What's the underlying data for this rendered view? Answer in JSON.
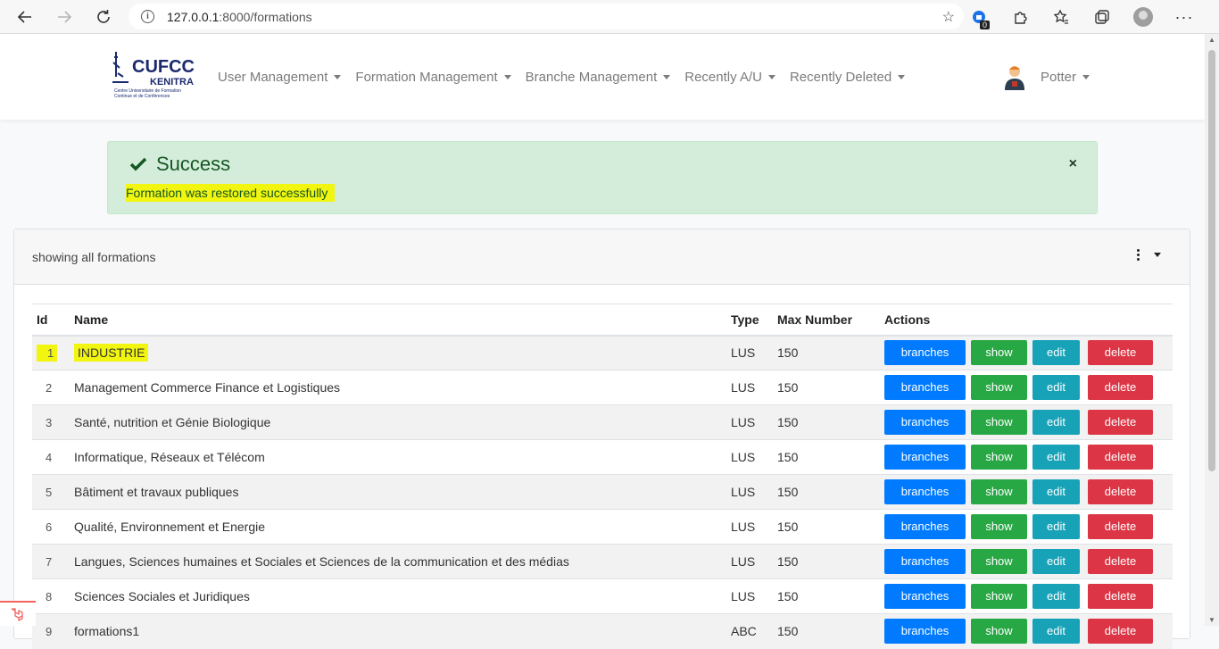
{
  "browser": {
    "url_host": "127.0.0.1",
    "url_path": ":8000/formations",
    "extension_badge": "0"
  },
  "logo": {
    "title": "CUFCC",
    "subtitle": "KENITRA",
    "tagline": "Centre Universitaire de Formation Continue et de Conférences"
  },
  "nav": {
    "items": [
      {
        "label": "User Management"
      },
      {
        "label": "Formation Management"
      },
      {
        "label": "Branche Management"
      },
      {
        "label": "Recently A/U"
      },
      {
        "label": "Recently Deleted"
      }
    ],
    "user": "Potter"
  },
  "alert": {
    "title": "Success",
    "message": "Formation was restored successfully",
    "close": "×",
    "color": "#d4edda"
  },
  "card": {
    "title": "showing all formations"
  },
  "table": {
    "headers": {
      "id": "Id",
      "name": "Name",
      "type": "Type",
      "max": "Max Number",
      "actions": "Actions"
    },
    "button_labels": {
      "branches": "branches",
      "show": "show",
      "edit": "edit",
      "delete": "delete"
    },
    "rows": [
      {
        "id": "1",
        "name": "INDUSTRIE",
        "type": "LUS",
        "max": "150"
      },
      {
        "id": "2",
        "name": "Management Commerce Finance et Logistiques",
        "type": "LUS",
        "max": "150"
      },
      {
        "id": "3",
        "name": "Santé, nutrition et Génie Biologique",
        "type": "LUS",
        "max": "150"
      },
      {
        "id": "4",
        "name": "Informatique, Réseaux et Télécom",
        "type": "LUS",
        "max": "150"
      },
      {
        "id": "5",
        "name": "Bâtiment et travaux publiques",
        "type": "LUS",
        "max": "150"
      },
      {
        "id": "6",
        "name": "Qualité, Environnement et Energie",
        "type": "LUS",
        "max": "150"
      },
      {
        "id": "7",
        "name": "Langues, Sciences humaines et Sociales et Sciences de la communication et des médias",
        "type": "LUS",
        "max": "150"
      },
      {
        "id": "8",
        "name": "Sciences Sociales et Juridiques",
        "type": "LUS",
        "max": "150"
      },
      {
        "id": "9",
        "name": "formations1",
        "type": "ABC",
        "max": "150"
      }
    ]
  },
  "colors": {
    "primary": "#007bff",
    "success": "#28a745",
    "info": "#17a2b8",
    "danger": "#dc3545",
    "highlight": "#f1f50f"
  }
}
